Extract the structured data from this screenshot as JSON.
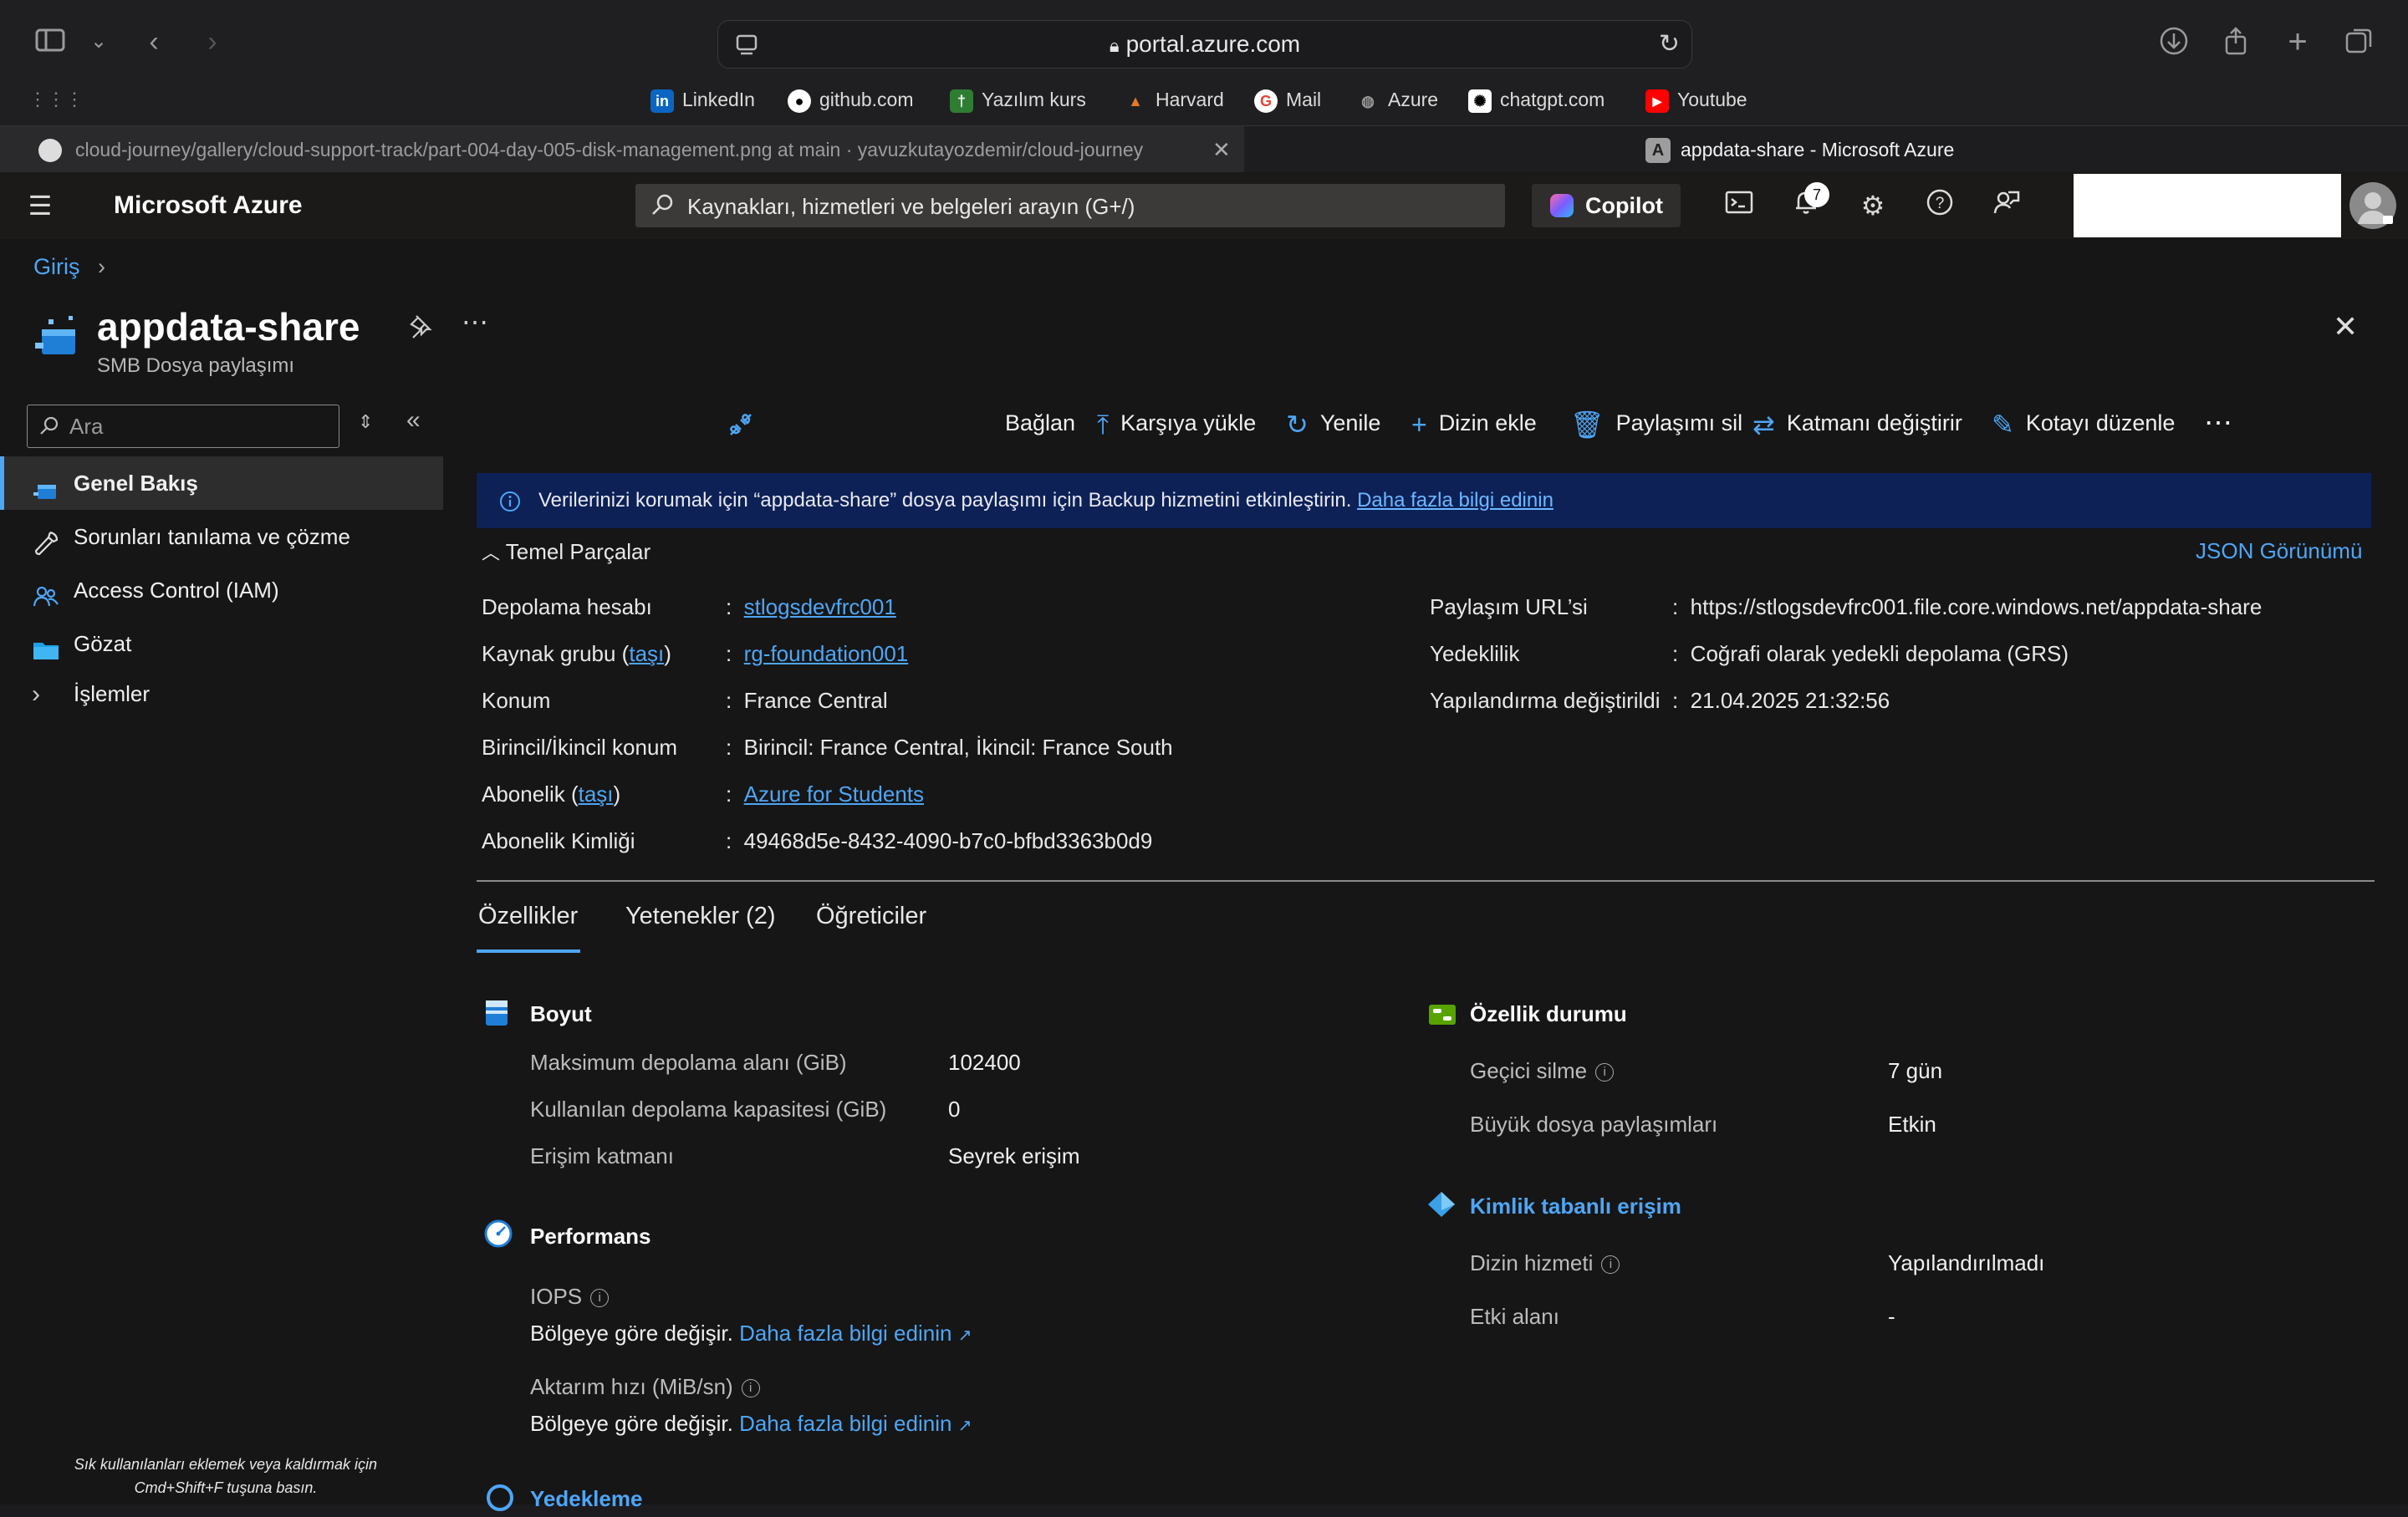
{
  "browser": {
    "url": "portal.azure.com",
    "bookmarks": [
      "LinkedIn",
      "github.com",
      "Yazılım kurs",
      "Harvard",
      "Mail",
      "Azure",
      "chatgpt.com",
      "Youtube"
    ],
    "tabs": [
      {
        "label": "cloud-journey/gallery/cloud-support-track/part-004-day-005-disk-management.png at main · yavuzkutayozdemir/cloud-journey"
      },
      {
        "label": "appdata-share - Microsoft Azure",
        "favicon": "A"
      }
    ]
  },
  "azure_header": {
    "brand": "Microsoft Azure",
    "search_placeholder": "Kaynakları, hizmetleri ve belgeleri arayın (G+/)",
    "copilot_label": "Copilot",
    "notification_count": "7"
  },
  "breadcrumb": {
    "root": "Giriş"
  },
  "blade": {
    "title": "appdata-share",
    "subtitle": "SMB Dosya paylaşımı"
  },
  "left_nav": {
    "search_placeholder": "Ara",
    "items": [
      {
        "label": "Genel Bakış",
        "selected": true
      },
      {
        "label": "Sorunları tanılama ve çözme"
      },
      {
        "label": "Access Control (IAM)"
      },
      {
        "label": "Gözat"
      },
      {
        "label": "İşlemler"
      }
    ],
    "footer_line1": "Sık kullanılanları eklemek veya kaldırmak için",
    "footer_line2": "Cmd+Shift+F tuşuna basın."
  },
  "toolbar": {
    "connect": "Bağlan",
    "upload": "Karşıya yükle",
    "refresh": "Yenile",
    "add_directory": "Dizin ekle",
    "delete_share": "Paylaşımı sil",
    "change_tier": "Katmanı değiştirir",
    "edit_quota": "Kotayı düzenle"
  },
  "banner": {
    "text": "Verilerinizi korumak için “appdata-share” dosya paylaşımı için Backup hizmetini etkinleştirin.",
    "link": "Daha fazla bilgi edinin"
  },
  "essentials": {
    "heading": "Temel Parçalar",
    "json_view": "JSON Görünümü",
    "left": [
      {
        "label": "Depolama hesabı",
        "value": "stlogsdevfrc001",
        "link": true
      },
      {
        "label": "Kaynak grubu",
        "move": "taşı",
        "value": "rg-foundation001",
        "link": true
      },
      {
        "label": "Konum",
        "value": "France Central"
      },
      {
        "label": "Birincil/İkincil konum",
        "value": "Birincil: France Central, İkincil: France South"
      },
      {
        "label": "Abonelik",
        "move": "taşı",
        "value": "Azure for Students",
        "link": true
      },
      {
        "label": "Abonelik Kimliği",
        "value": "49468d5e-8432-4090-b7c0-bfbd3363b0d9"
      }
    ],
    "right": [
      {
        "label": "Paylaşım URL’si",
        "value": "https://stlogsdevfrc001.file.core.windows.net/appdata-share"
      },
      {
        "label": "Yedeklilik",
        "value": "Coğrafi olarak yedekli depolama (GRS)"
      },
      {
        "label": "Yapılandırma değiştirildi",
        "value": "21.04.2025 21:32:56"
      }
    ]
  },
  "tabs": {
    "properties": "Özellikler",
    "capabilities": "Yetenekler (2)",
    "tutorials": "Öğreticiler"
  },
  "size_section": {
    "title": "Boyut",
    "max_label": "Maksimum depolama alanı (GiB)",
    "max_value": "102400",
    "used_label": "Kullanılan depolama kapasitesi (GiB)",
    "used_value": "0",
    "tier_label": "Erişim katmanı",
    "tier_value": "Seyrek erişim"
  },
  "performance_section": {
    "title": "Performans",
    "iops_label": "IOPS",
    "iops_text": "Bölgeye göre değişir.",
    "iops_link": "Daha fazla bilgi edinin",
    "throughput_label": "Aktarım hızı (MiB/sn)",
    "throughput_text": "Bölgeye göre değişir.",
    "throughput_link": "Daha fazla bilgi edinin"
  },
  "backup_section": {
    "title": "Yedekleme"
  },
  "feature_section": {
    "title": "Özellik durumu",
    "soft_delete_label": "Geçici silme",
    "soft_delete_value": "7 gün",
    "large_share_label": "Büyük dosya paylaşımları",
    "large_share_value": "Etkin"
  },
  "identity_section": {
    "title": "Kimlik tabanlı erişim",
    "directory_label": "Dizin hizmeti",
    "directory_value": "Yapılandırılmadı",
    "domain_label": "Etki alanı",
    "domain_value": "-"
  }
}
